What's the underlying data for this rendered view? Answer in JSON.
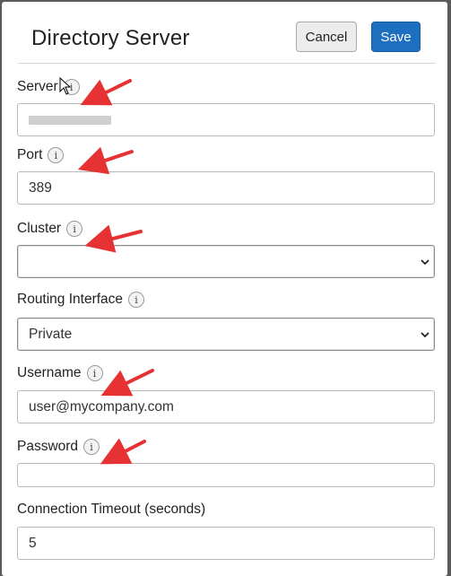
{
  "dialog": {
    "title": "Directory Server",
    "cancel_label": "Cancel",
    "save_label": "Save"
  },
  "fields": {
    "server": {
      "label": "Server",
      "value": ""
    },
    "port": {
      "label": "Port",
      "value": "389"
    },
    "cluster": {
      "label": "Cluster",
      "value": ""
    },
    "routing_interface": {
      "label": "Routing Interface",
      "value": "Private"
    },
    "username": {
      "label": "Username",
      "value": "user@mycompany.com"
    },
    "password": {
      "label": "Password",
      "value": ""
    },
    "connection_timeout": {
      "label": "Connection Timeout (seconds)",
      "value": "5"
    }
  },
  "info_glyph": "i",
  "colors": {
    "save_button": "#1f6fc1",
    "annotation_arrow": "#e63232",
    "backdrop": "#5a5a5a"
  }
}
